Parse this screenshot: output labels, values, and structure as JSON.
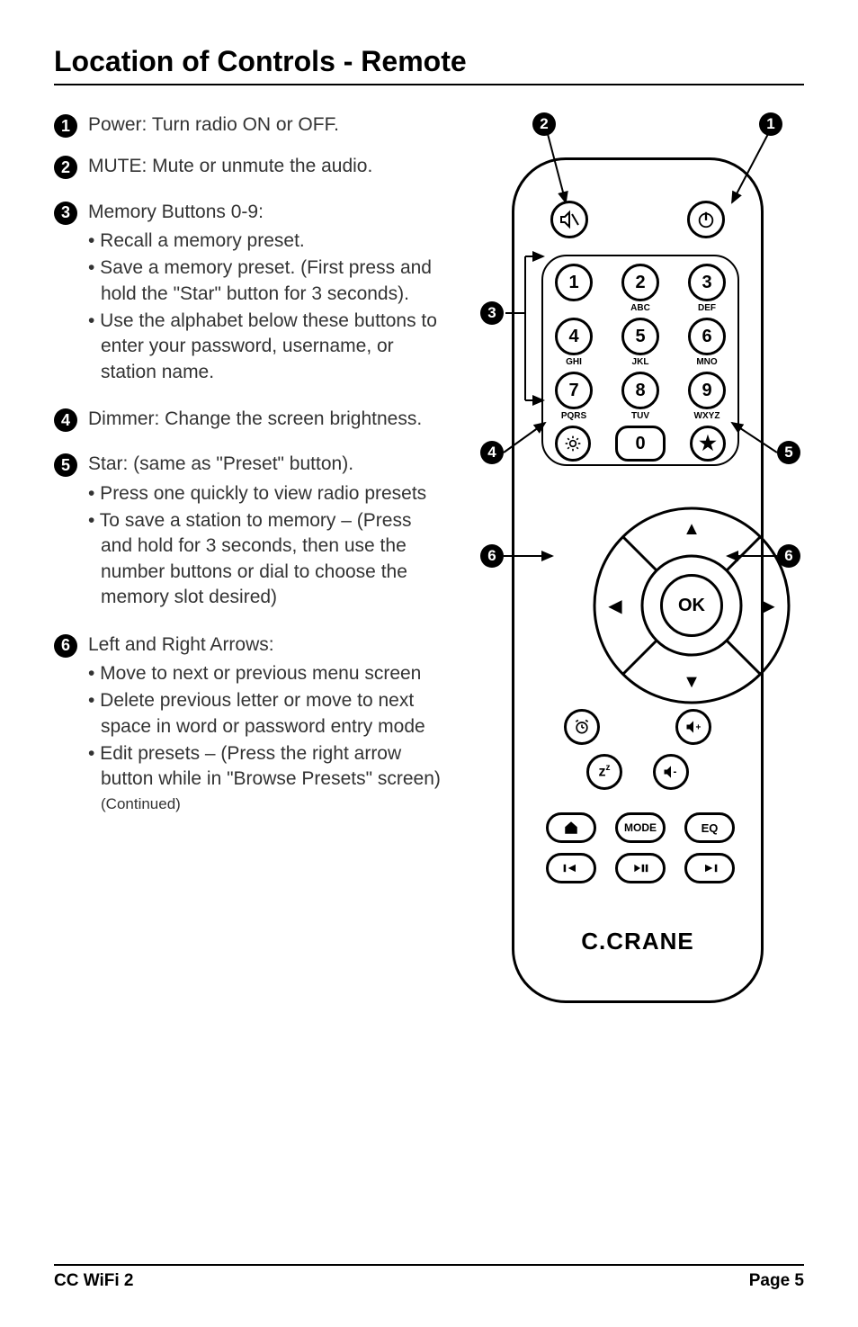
{
  "title": "Location of Controls - Remote",
  "items": [
    {
      "num": "1",
      "text": "Power: Turn radio ON or OFF."
    },
    {
      "num": "2",
      "text": "MUTE: Mute or unmute the audio."
    },
    {
      "num": "3",
      "text": "Memory Buttons 0-9:",
      "subs": [
        "• Recall a memory preset.",
        "• Save a memory preset. (First press and hold the \"Star\" button for 3 seconds).",
        "• Use the alphabet below these buttons to enter your password, username, or station name."
      ]
    },
    {
      "num": "4",
      "text": "Dimmer: Change the screen brightness."
    },
    {
      "num": "5",
      "text": "Star: (same as \"Preset\" button).",
      "subs": [
        "• Press one quickly to view radio presets",
        "• To save a station to memory – (Press and hold for 3 seconds, then use the number buttons or dial to choose the memory slot desired)"
      ]
    },
    {
      "num": "6",
      "text": "Left and Right Arrows:",
      "subs": [
        "• Move to next or previous menu screen",
        "• Delete previous letter or move to next space in word or password entry mode",
        "• Edit presets – (Press the right arrow button while in \"Browse Presets\" screen)"
      ],
      "continued": "(Continued)"
    }
  ],
  "remote": {
    "brand": "C.CRANE",
    "keypad_sub": {
      "2": "ABC",
      "3": "DEF",
      "4": "GHI",
      "5": "JKL",
      "6": "MNO",
      "7": "PQRS",
      "8": "TUV",
      "9": "WXYZ"
    },
    "ok": "OK",
    "mode": "MODE",
    "eq": "EQ"
  },
  "footer": {
    "left": "CC WiFi 2",
    "right": "Page 5"
  }
}
